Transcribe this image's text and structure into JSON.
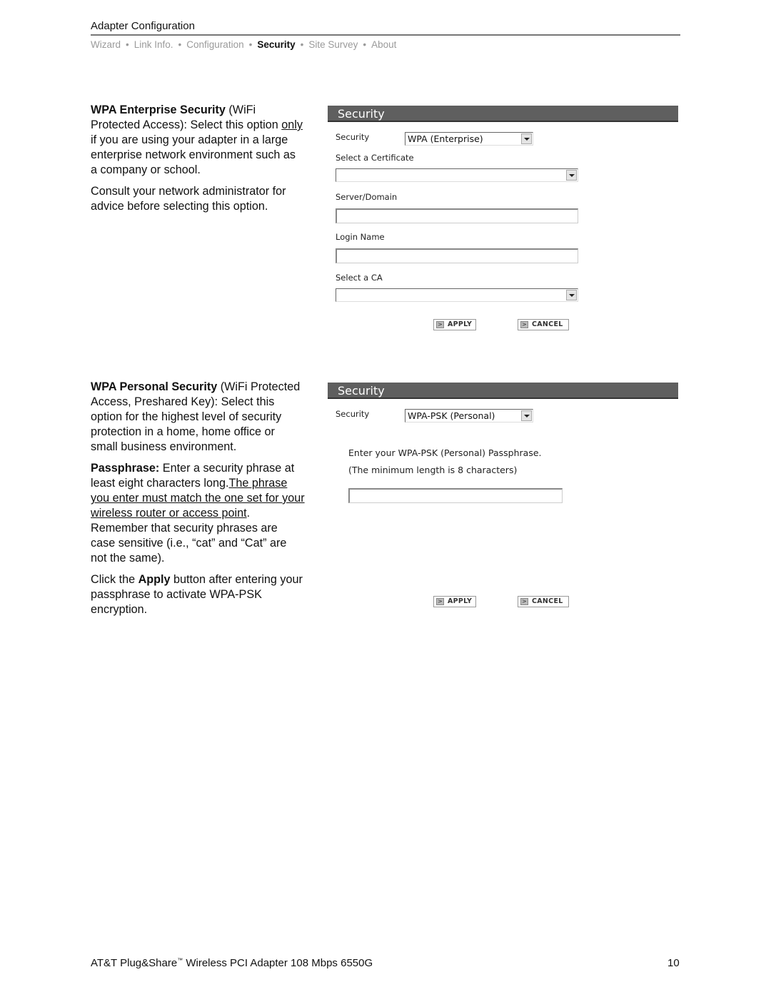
{
  "header": {
    "title": "Adapter Configuration",
    "nav": [
      {
        "label": "Wizard",
        "active": false
      },
      {
        "label": "Link Info.",
        "active": false
      },
      {
        "label": "Configuration",
        "active": false
      },
      {
        "label": "Security",
        "active": true
      },
      {
        "label": "Site Survey",
        "active": false
      },
      {
        "label": "About",
        "active": false
      }
    ],
    "nav_separator": "•"
  },
  "section1": {
    "heading_bold": "WPA Enterprise Security",
    "heading_rest": " (WiFi Protected Access): Select this option ",
    "underlined": "only",
    "after_underline": " if you are using your adapter in a large enterprise network environment such as a company or school.",
    "para2": "Consult your network administrator for advice before selecting this option.",
    "panel": {
      "title": "Security",
      "security_label": "Security",
      "security_value": "WPA (Enterprise)",
      "certificate_label": "Select a Certificate",
      "certificate_value": "",
      "server_label": "Server/Domain",
      "server_value": "",
      "login_label": "Login Name",
      "login_value": "",
      "ca_label": "Select a CA",
      "ca_value": "",
      "apply_label": "APPLY",
      "cancel_label": "CANCEL"
    }
  },
  "section2": {
    "heading_bold": "WPA Personal Security",
    "heading_rest": " (WiFi Protected Access, Preshared Key): Select this option for the highest level of security protection in a home, home office or small business environment.",
    "pass_bold": "Passphrase:",
    "pass_text": " Enter a security phrase at least eight characters long.",
    "pass_underlined": "The phrase you enter must match the one set for your wireless router or access point",
    "pass_after": ". Remember that security phrases are case sensitive (i.e., “cat” and “Cat” are not the same).",
    "click_pre": "Click the ",
    "click_bold": "Apply",
    "click_post": " button after entering your passphrase to activate WPA-PSK encryption.",
    "panel": {
      "title": "Security",
      "security_label": "Security",
      "security_value": "WPA-PSK (Personal)",
      "instruction_line1": "Enter your WPA-PSK (Personal) Passphrase.",
      "instruction_line2": "(The minimum length is 8 characters)",
      "passphrase_value": "",
      "apply_label": "APPLY",
      "cancel_label": "CANCEL"
    }
  },
  "footer": {
    "product_prefix": "AT&T Plug&Share",
    "trademark": "™",
    "product_suffix": " Wireless PCI Adapter 108 Mbps 6550G",
    "page_number": "10"
  }
}
